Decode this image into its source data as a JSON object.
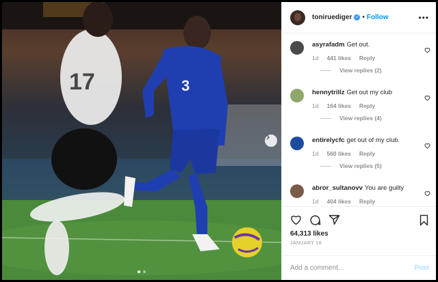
{
  "post": {
    "username": "toniruediger",
    "separator": "•",
    "follow_label": "Follow",
    "more_icon": "more-options-icon",
    "likes_count": "64,313 likes",
    "date": "JANUARY 16"
  },
  "photo": {
    "jersey_number": "17",
    "carousel_dots": 2,
    "active_dot": 0
  },
  "comments": [
    {
      "user": "asyrafadm",
      "text": "Get out.",
      "age": "1d",
      "likes": "441 likes",
      "reply": "Reply",
      "view_replies": "View replies (2)",
      "avatar_color": "#4a4a4a"
    },
    {
      "user": "hennytrillz",
      "text": "Get out my club",
      "age": "1d",
      "likes": "164 likes",
      "reply": "Reply",
      "view_replies": "View replies (4)",
      "avatar_color": "#8fa86a"
    },
    {
      "user": "entirelycfc",
      "text": "get out of my club.",
      "age": "1d",
      "likes": "560 likes",
      "reply": "Reply",
      "view_replies": "View replies (5)",
      "avatar_color": "#1c4ba0"
    },
    {
      "user": "abror_sultanovv",
      "text": "You are guilty",
      "age": "1d",
      "likes": "404 likes",
      "reply": "Reply",
      "view_replies": "",
      "avatar_color": "#7a5a48"
    }
  ],
  "add_comment": {
    "placeholder": "Add a comment...",
    "post_label": "Post"
  },
  "colors": {
    "link_blue": "#0095f6",
    "verified_blue": "#3897f0",
    "muted": "#8e8e8e",
    "chelsea_blue": "#1f3fb0"
  }
}
